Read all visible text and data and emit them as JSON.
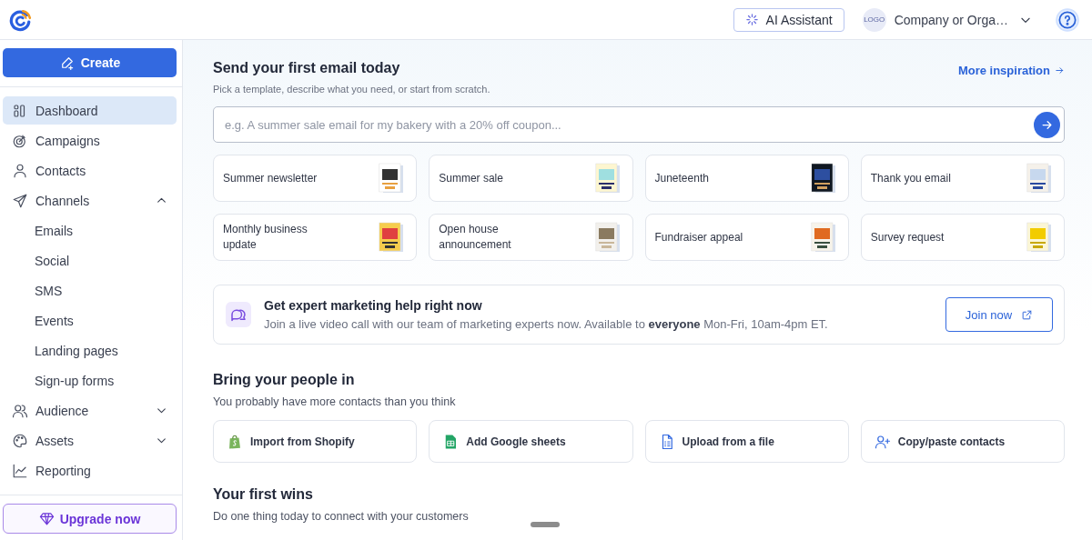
{
  "header": {
    "ai_button": "AI Assistant",
    "org_logo": "LOGO",
    "org_name": "Company or Orga…"
  },
  "sidebar": {
    "create_button": "Create",
    "items": [
      {
        "label": "Dashboard",
        "selected": true
      },
      {
        "label": "Campaigns",
        "selected": false
      },
      {
        "label": "Contacts",
        "selected": false
      },
      {
        "label": "Channels",
        "selected": false,
        "expanded": true,
        "children": [
          {
            "label": "Emails",
            "selected": false
          },
          {
            "label": "Social",
            "selected": false
          },
          {
            "label": "SMS",
            "selected": false
          },
          {
            "label": "Events",
            "selected": false
          },
          {
            "label": "Landing pages",
            "selected": false
          },
          {
            "label": "Sign-up forms",
            "selected": false
          }
        ]
      },
      {
        "label": "Audience",
        "selected": false,
        "expanded": false
      },
      {
        "label": "Assets",
        "selected": false,
        "expanded": false
      },
      {
        "label": "Reporting",
        "selected": false
      }
    ],
    "upgrade_button": "Upgrade now"
  },
  "first_email": {
    "title": "Send your first email today",
    "subtitle": "Pick a template, describe what you need, or start from scratch.",
    "link": "More inspiration",
    "prompt": {
      "placeholder": "e.g. A summer sale email for my bakery with a 20% off coupon..."
    },
    "templates": [
      {
        "label": "Summer newsletter"
      },
      {
        "label": "Summer sale"
      },
      {
        "label": "Juneteenth"
      },
      {
        "label": "Thank you email"
      },
      {
        "label": "Monthly business update"
      },
      {
        "label": "Open house announcement"
      },
      {
        "label": "Fundraiser appeal"
      },
      {
        "label": "Survey request"
      }
    ]
  },
  "expert_banner": {
    "title": "Get expert marketing help right now",
    "text": "Join a live video call with our team of marketing experts now. Available to **everyone** Mon-Fri, 10am-4pm ET.",
    "button": "Join now"
  },
  "people": {
    "title": "Bring your people in",
    "subtitle": "You probably have more contacts than you think",
    "actions": [
      {
        "label": "Import from Shopify"
      },
      {
        "label": "Add Google sheets"
      },
      {
        "label": "Upload from a file"
      },
      {
        "label": "Copy/paste contacts"
      }
    ]
  },
  "first_wins": {
    "title": "Your first wins",
    "subtitle": "Do one thing today to connect with your customers"
  }
}
